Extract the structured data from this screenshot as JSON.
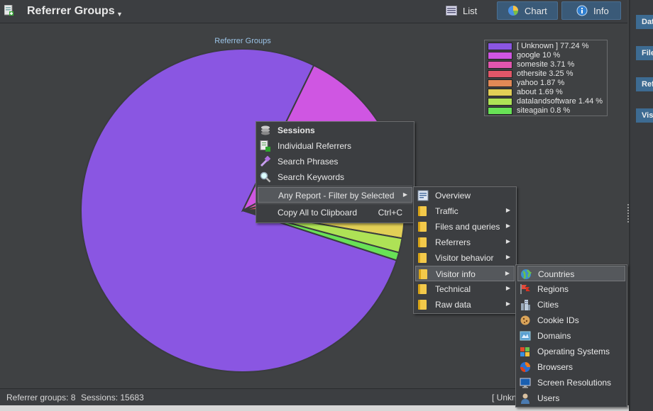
{
  "toolbar": {
    "title": "Referrer Groups",
    "list_label": "List",
    "chart_label": "Chart",
    "info_label": "Info"
  },
  "chart_data": {
    "type": "pie",
    "title": "Referrer Groups",
    "slices": [
      {
        "name": "[ Unknown ]",
        "label": "[ Unknown ] 77.24 %",
        "value": 77.24,
        "color": "#8a56e2"
      },
      {
        "name": "google",
        "label": "google 10 %",
        "value": 10,
        "color": "#cf56e2"
      },
      {
        "name": "somesite",
        "label": "somesite 3.71 %",
        "value": 3.71,
        "color": "#e256ae"
      },
      {
        "name": "othersite",
        "label": "othersite 3.25 %",
        "value": 3.25,
        "color": "#e25668"
      },
      {
        "name": "yahoo",
        "label": "yahoo 1.87 %",
        "value": 1.87,
        "color": "#e28956"
      },
      {
        "name": "about",
        "label": "about 1.69 %",
        "value": 1.69,
        "color": "#e2cf56"
      },
      {
        "name": "datalandsoftware",
        "label": "datalandsoftware 1.44 %",
        "value": 1.44,
        "color": "#aee256"
      },
      {
        "name": "siteagain",
        "label": "siteagain 0.8 %",
        "value": 0.8,
        "color": "#68e256"
      }
    ],
    "legend_position": "top-right"
  },
  "context_menu": {
    "items": [
      {
        "label": "Sessions",
        "icon": "stack-icon",
        "bold": true
      },
      {
        "label": "Individual Referrers",
        "icon": "page-export-icon"
      },
      {
        "label": "Search Phrases",
        "icon": "tools-icon"
      },
      {
        "label": "Search Keywords",
        "icon": "magnifier-icon"
      },
      {
        "label": "Any Report - Filter by Selected",
        "has_submenu": true
      },
      {
        "label": "Copy All to Clipboard",
        "shortcut": "Ctrl+C"
      }
    ]
  },
  "report_menu": {
    "items": [
      {
        "label": "Overview",
        "icon": "overview-icon"
      },
      {
        "label": "Traffic",
        "icon": "folder-icon",
        "has_submenu": true
      },
      {
        "label": "Files and queries",
        "icon": "folder-icon",
        "has_submenu": true
      },
      {
        "label": "Referrers",
        "icon": "folder-icon",
        "has_submenu": true
      },
      {
        "label": "Visitor behavior",
        "icon": "folder-icon",
        "has_submenu": true
      },
      {
        "label": "Visitor info",
        "icon": "folder-icon",
        "has_submenu": true
      },
      {
        "label": "Technical",
        "icon": "folder-icon",
        "has_submenu": true
      },
      {
        "label": "Raw data",
        "icon": "folder-icon",
        "has_submenu": true
      }
    ]
  },
  "visitor_menu": {
    "items": [
      {
        "label": "Countries",
        "icon": "globe-icon"
      },
      {
        "label": "Regions",
        "icon": "flag-icon"
      },
      {
        "label": "Cities",
        "icon": "city-icon"
      },
      {
        "label": "Cookie IDs",
        "icon": "cookie-icon"
      },
      {
        "label": "Domains",
        "icon": "domain-icon"
      },
      {
        "label": "Operating Systems",
        "icon": "os-icon"
      },
      {
        "label": "Browsers",
        "icon": "browser-icon"
      },
      {
        "label": "Screen Resolutions",
        "icon": "monitor-icon"
      },
      {
        "label": "Users",
        "icon": "user-icon"
      }
    ]
  },
  "status": {
    "groups": "Referrer groups: 8",
    "sessions": "Sessions: 15683",
    "hover": "[ Unkn"
  },
  "right_panel": {
    "tabs": [
      "Dat",
      "File",
      "Ref",
      "Visi"
    ]
  }
}
